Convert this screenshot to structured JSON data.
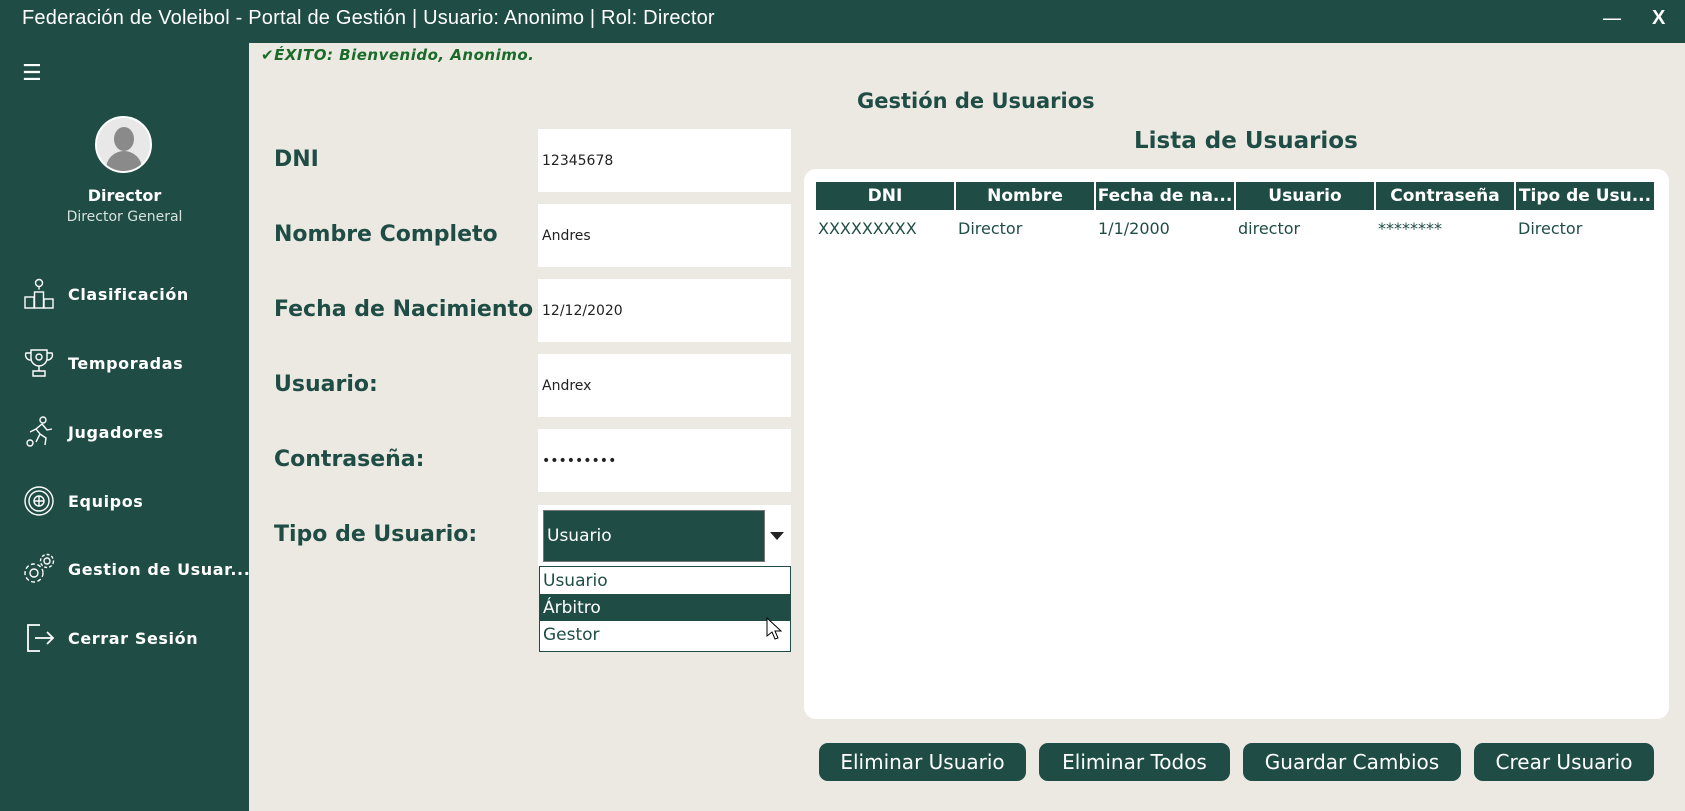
{
  "window": {
    "title": "Federación de Voleibol - Portal de Gestión | Usuario: Anonimo | Rol: Director",
    "minimize_label": "—",
    "close_label": "X"
  },
  "sidebar": {
    "menu_icon": "☰",
    "profile": {
      "name": "Director",
      "role": "Director General"
    },
    "items": [
      {
        "label": "Clasificación",
        "icon": "podium-icon"
      },
      {
        "label": "Temporadas",
        "icon": "trophy-icon"
      },
      {
        "label": "Jugadores",
        "icon": "player-icon"
      },
      {
        "label": "Equipos",
        "icon": "team-badge-icon"
      },
      {
        "label": "Gestion de Usuar...",
        "icon": "gears-icon"
      },
      {
        "label": "Cerrar Sesión",
        "icon": "logout-icon"
      }
    ]
  },
  "status": {
    "message": "✔ÉXITO: Bienvenido, Anonimo."
  },
  "page": {
    "title": "Gestión de Usuarios"
  },
  "form": {
    "dni": {
      "label": "DNI",
      "value": "12345678"
    },
    "nombre": {
      "label": "Nombre Completo",
      "value": "Andres"
    },
    "fecha": {
      "label": "Fecha de Nacimiento",
      "value": "12/12/2020"
    },
    "usuario": {
      "label": "Usuario:",
      "value": "Andrex"
    },
    "password": {
      "label": "Contraseña:",
      "value": "•••••••••"
    },
    "tipo": {
      "label": "Tipo de Usuario:",
      "selected": "Usuario",
      "options": [
        "Usuario",
        "Árbitro",
        "Gestor"
      ],
      "highlighted": "Árbitro"
    }
  },
  "table": {
    "title": "Lista de Usuarios",
    "columns": [
      "DNI",
      "Nombre",
      "Fecha de na...",
      "Usuario",
      "Contraseña",
      "Tipo de Usu..."
    ],
    "rows": [
      [
        "XXXXXXXXX",
        "Director",
        "1/1/2000",
        "director",
        "********",
        "Director"
      ]
    ]
  },
  "actions": {
    "delete_user": "Eliminar Usuario",
    "delete_all": "Eliminar Todos",
    "save": "Guardar Cambios",
    "create": "Crear Usuario"
  },
  "colors": {
    "primary": "#1f4d45",
    "background": "#ebe9e1",
    "success": "#1a6b2a"
  }
}
